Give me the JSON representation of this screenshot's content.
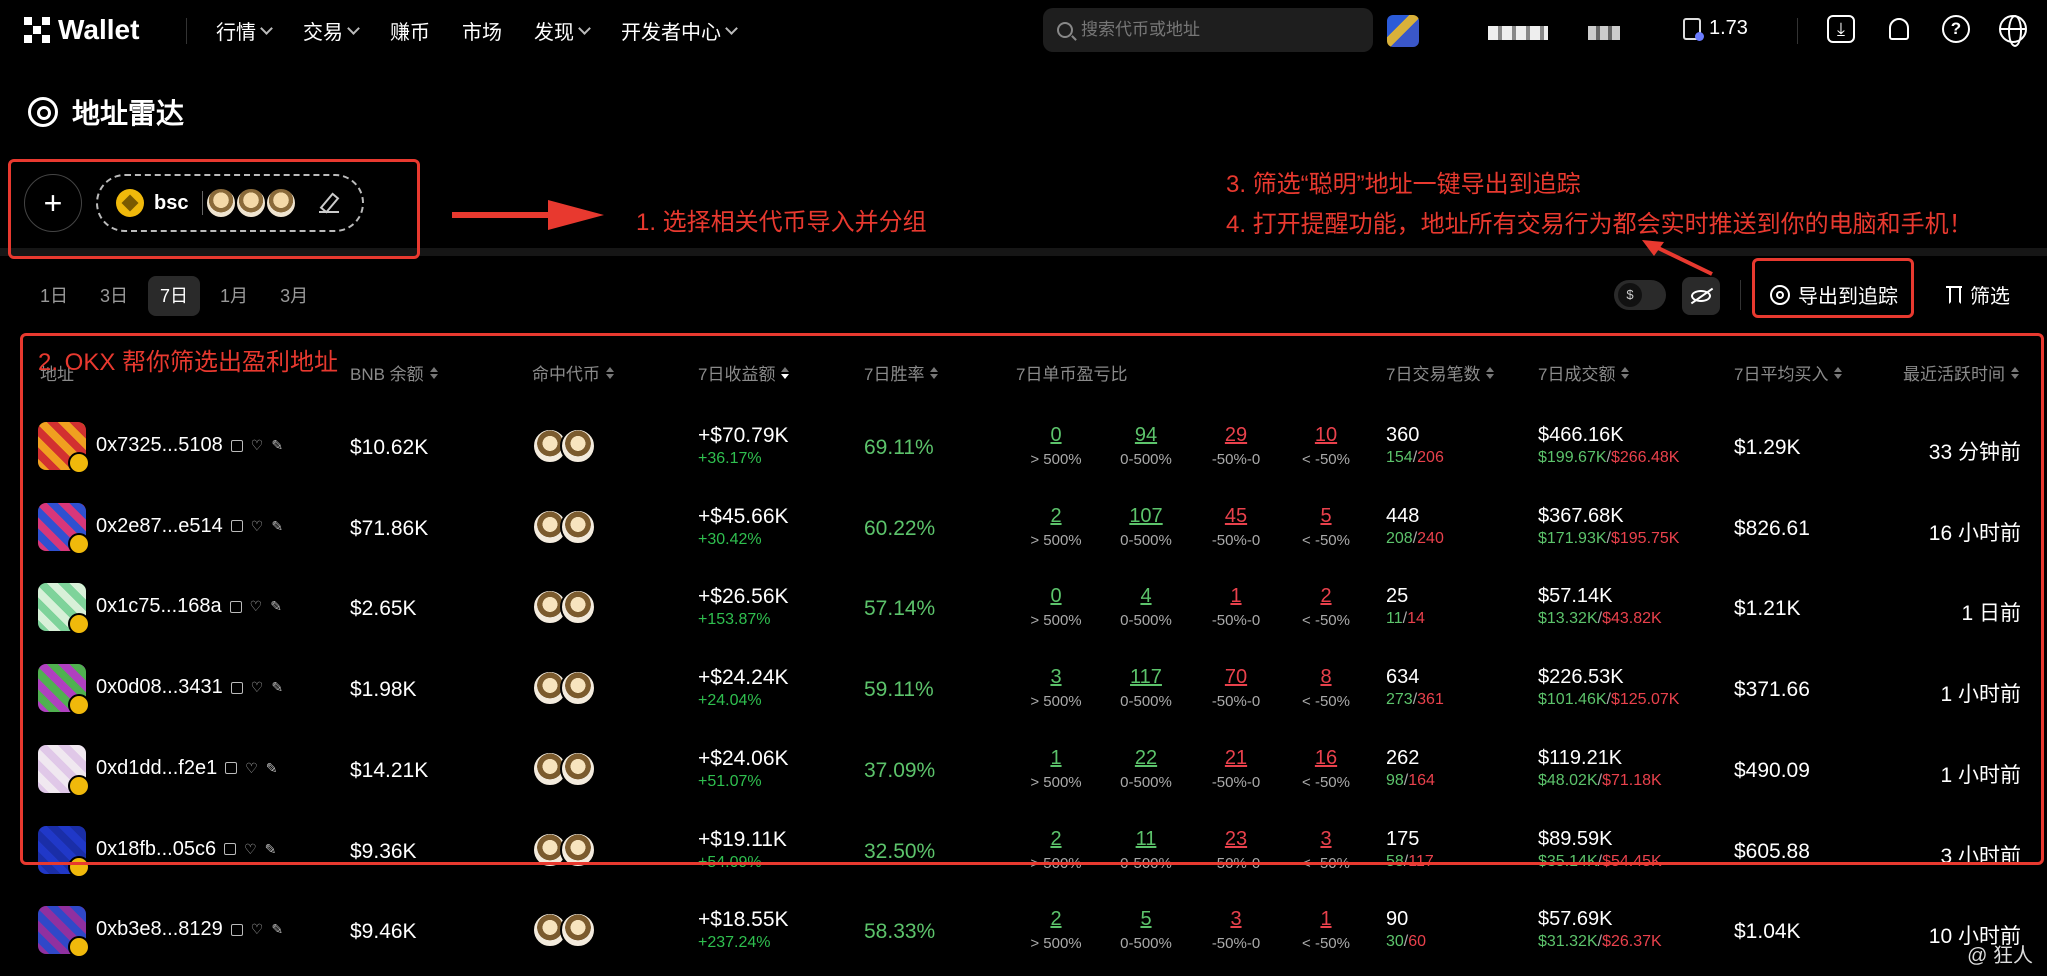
{
  "header": {
    "brand": "Wallet",
    "nav": [
      {
        "label": "行情",
        "dropdown": true
      },
      {
        "label": "交易",
        "dropdown": true
      },
      {
        "label": "赚币",
        "dropdown": false
      },
      {
        "label": "市场",
        "dropdown": false
      },
      {
        "label": "发现",
        "dropdown": true
      },
      {
        "label": "开发者中心",
        "dropdown": true
      }
    ],
    "search_placeholder": "搜索代币或地址",
    "gas_value": "1.73"
  },
  "page": {
    "title": "地址雷达",
    "group_name": "bsc",
    "tabs": [
      "1日",
      "3日",
      "7日",
      "1月",
      "3月"
    ],
    "active_tab": "7日",
    "toggle_symbol": "$",
    "export_label": "导出到追踪",
    "filter_label": "筛选"
  },
  "table": {
    "columns": [
      "地址",
      "BNB 余额",
      "命中代币",
      "7日收益额",
      "7日胜率",
      "7日单币盈亏比",
      "7日交易笔数",
      "7日成交额",
      "7日平均买入",
      "最近活跃时间"
    ],
    "dist_labels": [
      "> 500%",
      "0-500%",
      "-50%-0",
      "< -50%"
    ],
    "rows": [
      {
        "addr": "0x7325...5108",
        "bal": "$10.62K",
        "pnl": "+$70.79K",
        "pnl_pct": "+36.17%",
        "win": "69.11%",
        "dist": [
          "0",
          "94",
          "29",
          "10"
        ],
        "trades": "360",
        "buys": "154",
        "sells": "206",
        "vol": "$466.16K",
        "vol_buy": "$199.67K",
        "vol_sell": "$266.48K",
        "avg": "$1.29K",
        "last": "33 分钟前"
      },
      {
        "addr": "0x2e87...e514",
        "bal": "$71.86K",
        "pnl": "+$45.66K",
        "pnl_pct": "+30.42%",
        "win": "60.22%",
        "dist": [
          "2",
          "107",
          "45",
          "5"
        ],
        "trades": "448",
        "buys": "208",
        "sells": "240",
        "vol": "$367.68K",
        "vol_buy": "$171.93K",
        "vol_sell": "$195.75K",
        "avg": "$826.61",
        "last": "16 小时前"
      },
      {
        "addr": "0x1c75...168a",
        "bal": "$2.65K",
        "pnl": "+$26.56K",
        "pnl_pct": "+153.87%",
        "win": "57.14%",
        "dist": [
          "0",
          "4",
          "1",
          "2"
        ],
        "trades": "25",
        "buys": "11",
        "sells": "14",
        "vol": "$57.14K",
        "vol_buy": "$13.32K",
        "vol_sell": "$43.82K",
        "avg": "$1.21K",
        "last": "1 日前"
      },
      {
        "addr": "0x0d08...3431",
        "bal": "$1.98K",
        "pnl": "+$24.24K",
        "pnl_pct": "+24.04%",
        "win": "59.11%",
        "dist": [
          "3",
          "117",
          "70",
          "8"
        ],
        "trades": "634",
        "buys": "273",
        "sells": "361",
        "vol": "$226.53K",
        "vol_buy": "$101.46K",
        "vol_sell": "$125.07K",
        "avg": "$371.66",
        "last": "1 小时前"
      },
      {
        "addr": "0xd1dd...f2e1",
        "bal": "$14.21K",
        "pnl": "+$24.06K",
        "pnl_pct": "+51.07%",
        "win": "37.09%",
        "dist": [
          "1",
          "22",
          "21",
          "16"
        ],
        "trades": "262",
        "buys": "98",
        "sells": "164",
        "vol": "$119.21K",
        "vol_buy": "$48.02K",
        "vol_sell": "$71.18K",
        "avg": "$490.09",
        "last": "1 小时前"
      },
      {
        "addr": "0x18fb...05c6",
        "bal": "$9.36K",
        "pnl": "+$19.11K",
        "pnl_pct": "+54.09%",
        "win": "32.50%",
        "dist": [
          "2",
          "11",
          "23",
          "3"
        ],
        "trades": "175",
        "buys": "58",
        "sells": "117",
        "vol": "$89.59K",
        "vol_buy": "$35.14K",
        "vol_sell": "$54.45K",
        "avg": "$605.88",
        "last": "3 小时前"
      },
      {
        "addr": "0xb3e8...8129",
        "bal": "$9.46K",
        "pnl": "+$18.55K",
        "pnl_pct": "+237.24%",
        "win": "58.33%",
        "dist": [
          "2",
          "5",
          "3",
          "1"
        ],
        "trades": "90",
        "buys": "30",
        "sells": "60",
        "vol": "$57.69K",
        "vol_buy": "$31.32K",
        "vol_sell": "$26.37K",
        "avg": "$1.04K",
        "last": "10 小时前"
      }
    ]
  },
  "annotations": {
    "step1": "1. 选择相关代币导入并分组",
    "step2": "2. OKX 帮你筛选出盈利地址",
    "step3": "3. 筛选“聪明”地址一键导出到追踪",
    "step4": "4. 打开提醒功能，地址所有交易行为都会实时推送到你的电脑和手机！"
  },
  "watermark": "@ 狂人",
  "colors": {
    "accent_red": "#e8392f",
    "gain": "#2fbf4f",
    "loss": "#e9414c"
  },
  "avatars": [
    [
      "#f0a020",
      "#d23030"
    ],
    [
      "#d8377a",
      "#3050d0"
    ],
    [
      "#7ed39a",
      "#d8f0d8"
    ],
    [
      "#b040c0",
      "#50b050"
    ],
    [
      "#e0c8e8",
      "#f0e8f0"
    ],
    [
      "#2038c8",
      "#1a2ea8"
    ],
    [
      "#9030a0",
      "#3048c8"
    ]
  ]
}
